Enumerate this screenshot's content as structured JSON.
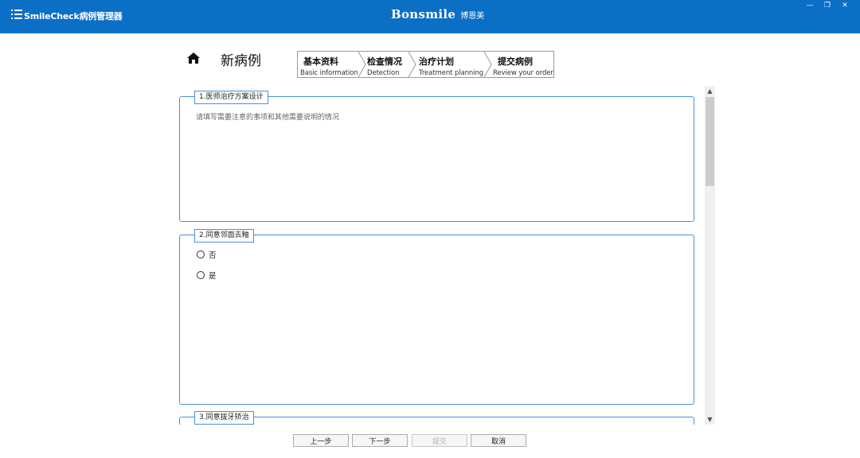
{
  "app": {
    "title": "SmileCheck病例管理器",
    "brand_en": "Bonsmile",
    "brand_cn": "博恩美",
    "win_controls": [
      "—",
      "❐",
      "✕"
    ]
  },
  "header": {
    "page_title": "新病例",
    "steps": [
      {
        "cn": "基本资料",
        "en": "Basic information"
      },
      {
        "cn": "检查情况",
        "en": "Detection"
      },
      {
        "cn": "治疗计划",
        "en": "Treatment planning"
      },
      {
        "cn": "提交病例",
        "en": "Review your order"
      }
    ]
  },
  "sections": [
    {
      "legend": "1.医师治疗方案设计",
      "placeholder": "请填写需要注意的事项和其他需要说明的情况",
      "value": ""
    },
    {
      "legend": "2.同意邻面去釉",
      "options": [
        "否",
        "是"
      ]
    },
    {
      "legend": "3.同意拔牙矫治"
    }
  ],
  "footer": {
    "prev": "上一步",
    "next": "下一步",
    "submit": "提交",
    "cancel": "取消"
  },
  "colors": {
    "topbar": "#0b6fc5",
    "section_border": "#4a90d9"
  },
  "icons": {
    "menu": "menu-icon",
    "home": "home-icon"
  }
}
